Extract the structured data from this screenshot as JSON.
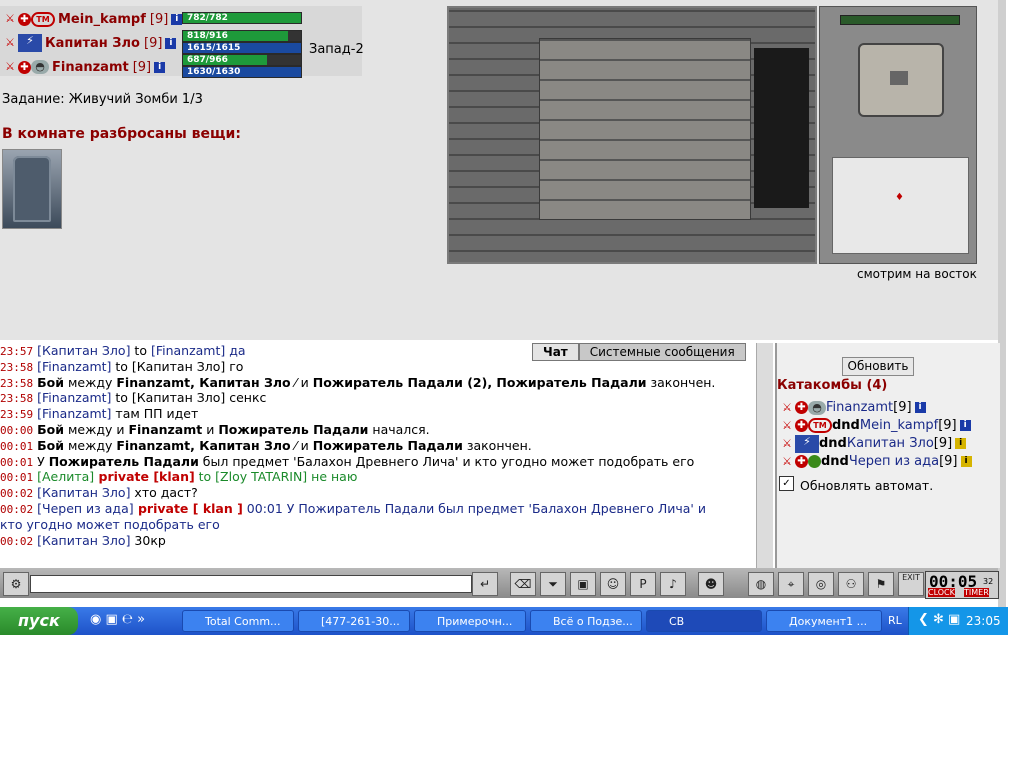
{
  "party": [
    {
      "name": "Mein_kampf",
      "level": "[9]",
      "hp": "782/782",
      "hp_pct": 1.0,
      "mp": "",
      "mp_pct": 0
    },
    {
      "name": "Капитан Зло",
      "level": "[9]",
      "hp": "818/916",
      "hp_pct": 0.89,
      "mp": "1615/1615",
      "mp_pct": 1.0
    },
    {
      "name": "Finanzamt",
      "level": "[9]",
      "hp": "687/966",
      "hp_pct": 0.71,
      "mp": "1630/1630",
      "mp_pct": 1.0
    }
  ],
  "direction_label": "Запад-2",
  "task": "Задание: Живучий Зомби 1/3",
  "items_title": "В комнате разбросаны вещи:",
  "look_label": "смотрим на восток",
  "chat_tabs": [
    "Чат",
    "Системные сообщения"
  ],
  "chat": [
    {
      "time": "23:57",
      "html": [
        [
          "nm",
          "[Капитан Зло]"
        ],
        [
          "",
          " to "
        ],
        [
          "bl",
          "[Finanzamt] да"
        ]
      ]
    },
    {
      "time": "23:58",
      "html": [
        [
          "nm",
          "[Finanzamt]"
        ],
        [
          "",
          " to [Капитан Зло] го"
        ]
      ]
    },
    {
      "time": "23:58",
      "html": [
        [
          "b",
          "Бой"
        ],
        [
          "",
          " между "
        ],
        [
          "b",
          "Finanzamt, Капитан Зло"
        ],
        [
          "",
          " ⁄ и "
        ],
        [
          "b",
          "Пожиратель Падали (2), Пожиратель Падали"
        ],
        [
          "",
          " закончен."
        ]
      ]
    },
    {
      "time": "23:58",
      "html": [
        [
          "nm",
          "[Finanzamt]"
        ],
        [
          "",
          " to [Капитан Зло] сенкс"
        ]
      ]
    },
    {
      "time": "23:59",
      "html": [
        [
          "nm",
          "[Finanzamt]"
        ],
        [
          "",
          " там ПП идет"
        ]
      ]
    },
    {
      "time": "00:00",
      "html": [
        [
          "b",
          "Бой"
        ],
        [
          "",
          " между и "
        ],
        [
          "b",
          "Finanzamt"
        ],
        [
          "",
          " и "
        ],
        [
          "b",
          "Пожиратель Падали"
        ],
        [
          "",
          " начался."
        ]
      ]
    },
    {
      "time": "00:01",
      "html": [
        [
          "b",
          "Бой"
        ],
        [
          "",
          " между "
        ],
        [
          "b",
          "Finanzamt, Капитан Зло"
        ],
        [
          "",
          " ⁄ и "
        ],
        [
          "b",
          "Пожиратель Падали"
        ],
        [
          "",
          " закончен."
        ]
      ]
    },
    {
      "time": "00:01",
      "html": [
        [
          "",
          "У "
        ],
        [
          "b",
          "Пожиратель Падали"
        ],
        [
          "",
          " был предмет 'Балахон Древнего Лича' и кто угодно может подобрать его"
        ]
      ]
    },
    {
      "time": "00:01",
      "html": [
        [
          "gr",
          "[Аелита]"
        ],
        [
          "priv",
          " private [klan]"
        ],
        [
          "gr",
          " to [Zloy TATARIN] не наю"
        ]
      ]
    },
    {
      "time": "00:02",
      "html": [
        [
          "nm",
          "[Капитан Зло]"
        ],
        [
          "",
          " хто даст?"
        ]
      ]
    },
    {
      "time": "00:02",
      "html": [
        [
          "nm",
          "[Череп из ада]"
        ],
        [
          "priv",
          " private [ klan ]"
        ],
        [
          "bl",
          " 00:01 У Пожиратель Падали был предмет 'Балахон Древнего Лича' и"
        ]
      ]
    },
    {
      "time": "",
      "html": [
        [
          "bl",
          "кто угодно может подобрать его"
        ]
      ]
    },
    {
      "time": "00:02",
      "html": [
        [
          "nm",
          "[Капитан Зло]"
        ],
        [
          "",
          " 30кр"
        ]
      ]
    }
  ],
  "refresh_button": "Обновить",
  "room_title": "Катакомбы (4)",
  "room_members": [
    {
      "prefix": "",
      "name": "Finanzamt",
      "level": "[9]"
    },
    {
      "prefix": "dnd ",
      "name": "Mein_kampf",
      "level": "[9]"
    },
    {
      "prefix": "dnd ",
      "name": "Капитан Зло",
      "level": "[9]"
    },
    {
      "prefix": "dnd ",
      "name": "Череп из ада",
      "level": "[9]"
    }
  ],
  "auto_refresh_label": "Обновлять автомат.",
  "game_clock": {
    "time": "00:05",
    "sec": "32",
    "clock_label": "CLOCK",
    "timer_label": "TIMER"
  },
  "exit_label": "EXIT",
  "taskbar": {
    "start": "пуск",
    "buttons": [
      "Total Comm...",
      "[477-261-30...",
      "Примерочн...",
      "Всё о Подзе...",
      "CB",
      "Документ1 ..."
    ],
    "lang": "RL",
    "clock": "23:05"
  }
}
